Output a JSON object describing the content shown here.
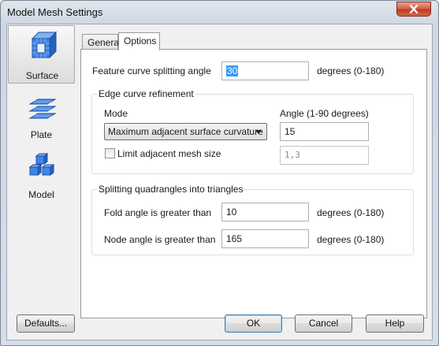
{
  "window": {
    "title": "Model Mesh Settings"
  },
  "nav": {
    "items": [
      {
        "label": "Surface",
        "icon": "surface-mesh-icon",
        "selected": true
      },
      {
        "label": "Plate",
        "icon": "plate-mesh-icon",
        "selected": false
      },
      {
        "label": "Model",
        "icon": "model-mesh-icon",
        "selected": false
      }
    ]
  },
  "tabs": [
    {
      "label": "General",
      "active": false
    },
    {
      "label": "Options",
      "active": true
    }
  ],
  "options": {
    "feature_curve": {
      "label": "Feature curve splitting angle",
      "value": "30",
      "units": "degrees (0-180)"
    },
    "edge_refinement": {
      "title": "Edge curve refinement",
      "mode_label": "Mode",
      "angle_label": "Angle (1-90 degrees)",
      "mode_value": "Maximum adjacent surface curvature",
      "angle_value": "15",
      "limit_label": "Limit adjacent mesh size",
      "limit_checked": false,
      "limit_value": "1,3"
    },
    "splitting": {
      "title": "Splitting quadrangles into triangles",
      "fold_label": "Fold angle is greater than",
      "fold_value": "10",
      "fold_units": "degrees (0-180)",
      "node_label": "Node angle is greater than",
      "node_value": "165",
      "node_units": "degrees (0-180)"
    }
  },
  "buttons": {
    "defaults": "Defaults...",
    "ok": "OK",
    "cancel": "Cancel",
    "help": "Help"
  },
  "colors": {
    "icon_blue": "#2a6fd6",
    "selection": "#3399ff",
    "close_red": "#c94a30"
  }
}
